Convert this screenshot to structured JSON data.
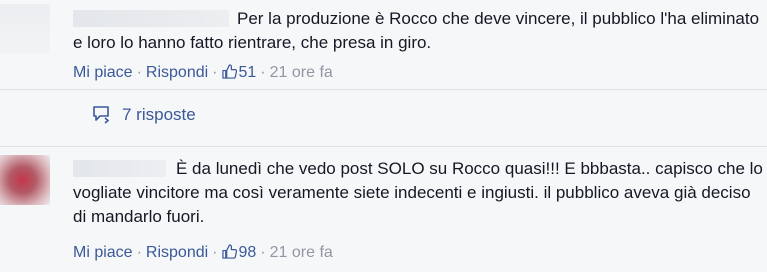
{
  "comments": [
    {
      "text": "Per la produzione è Rocco che deve vincere, il pubblico l'ha eliminato e loro lo hanno fatto rientrare, che presa in giro.",
      "actions": {
        "like_label": "Mi piace",
        "reply_label": "Rispondi",
        "like_count": "51",
        "time": "21 ore fa"
      },
      "replies_label": "7 risposte"
    },
    {
      "text": "È da lunedì che vedo post SOLO su Rocco quasi!!! E bbbasta.. capisco che lo vogliate vincitore ma così veramente siete indecenti e ingiusti. il pubblico aveva già deciso di mandarlo fuori.",
      "actions": {
        "like_label": "Mi piace",
        "reply_label": "Rispondi",
        "like_count": "98",
        "time": "21 ore fa"
      }
    }
  ],
  "icons": {
    "like": "thumbs-up-icon",
    "replies": "reply-arrow-icon"
  },
  "colors": {
    "link": "#3b5998",
    "meta": "#9197a3",
    "text": "#141823",
    "background": "#f6f7f9"
  }
}
